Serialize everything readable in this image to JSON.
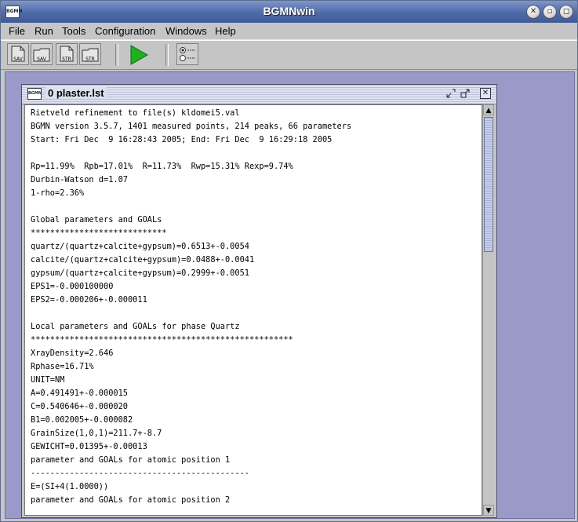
{
  "window": {
    "title": "BGMNwin",
    "app_icon_text": "BGMN",
    "controls": [
      "✕",
      "▫",
      "◻"
    ]
  },
  "menu": {
    "file": "File",
    "run": "Run",
    "tools": "Tools",
    "configuration": "Configuration",
    "windows": "Windows",
    "help": "Help"
  },
  "toolbar": {
    "save1_label": "SAV",
    "save2_label": "SAV",
    "str1_label": "STR",
    "str2_label": "STR",
    "play_icon": "play-icon",
    "play_color": "#1fb01f",
    "options_icon": "radio-list-icon"
  },
  "desktop": {
    "background": "#9a9ac9"
  },
  "document": {
    "title": "0 plaster.lst",
    "icon_text": "BGMN",
    "lines": [
      "Rietveld refinement to file(s) kldomei5.val",
      "BGMN version 3.5.7, 1401 measured points, 214 peaks, 66 parameters",
      "Start: Fri Dec  9 16:28:43 2005; End: Fri Dec  9 16:29:18 2005",
      "",
      "Rp=11.99%  Rpb=17.01%  R=11.73%  Rwp=15.31% Rexp=9.74%",
      "Durbin-Watson d=1.07",
      "1-rho=2.36%",
      "",
      "Global parameters and GOALs",
      "****************************",
      "quartz/(quartz+calcite+gypsum)=0.6513+-0.0054",
      "calcite/(quartz+calcite+gypsum)=0.0488+-0.0041",
      "gypsum/(quartz+calcite+gypsum)=0.2999+-0.0051",
      "EPS1=-0.000100000",
      "EPS2=-0.000206+-0.000011",
      "",
      "Local parameters and GOALs for phase Quartz",
      "******************************************************",
      "XrayDensity=2.646",
      "Rphase=16.71%",
      "UNIT=NM",
      "A=0.491491+-0.000015",
      "C=0.540646+-0.000020",
      "B1=0.002005+-0.000082",
      "GrainSize(1,0,1)=211.7+-8.7",
      "GEWICHT=0.01395+-0.00013",
      "parameter and GOALs for atomic position 1",
      "---------------------------------------------",
      "E=(SI+4(1.0000))",
      "parameter and GOALs for atomic position 2"
    ]
  }
}
